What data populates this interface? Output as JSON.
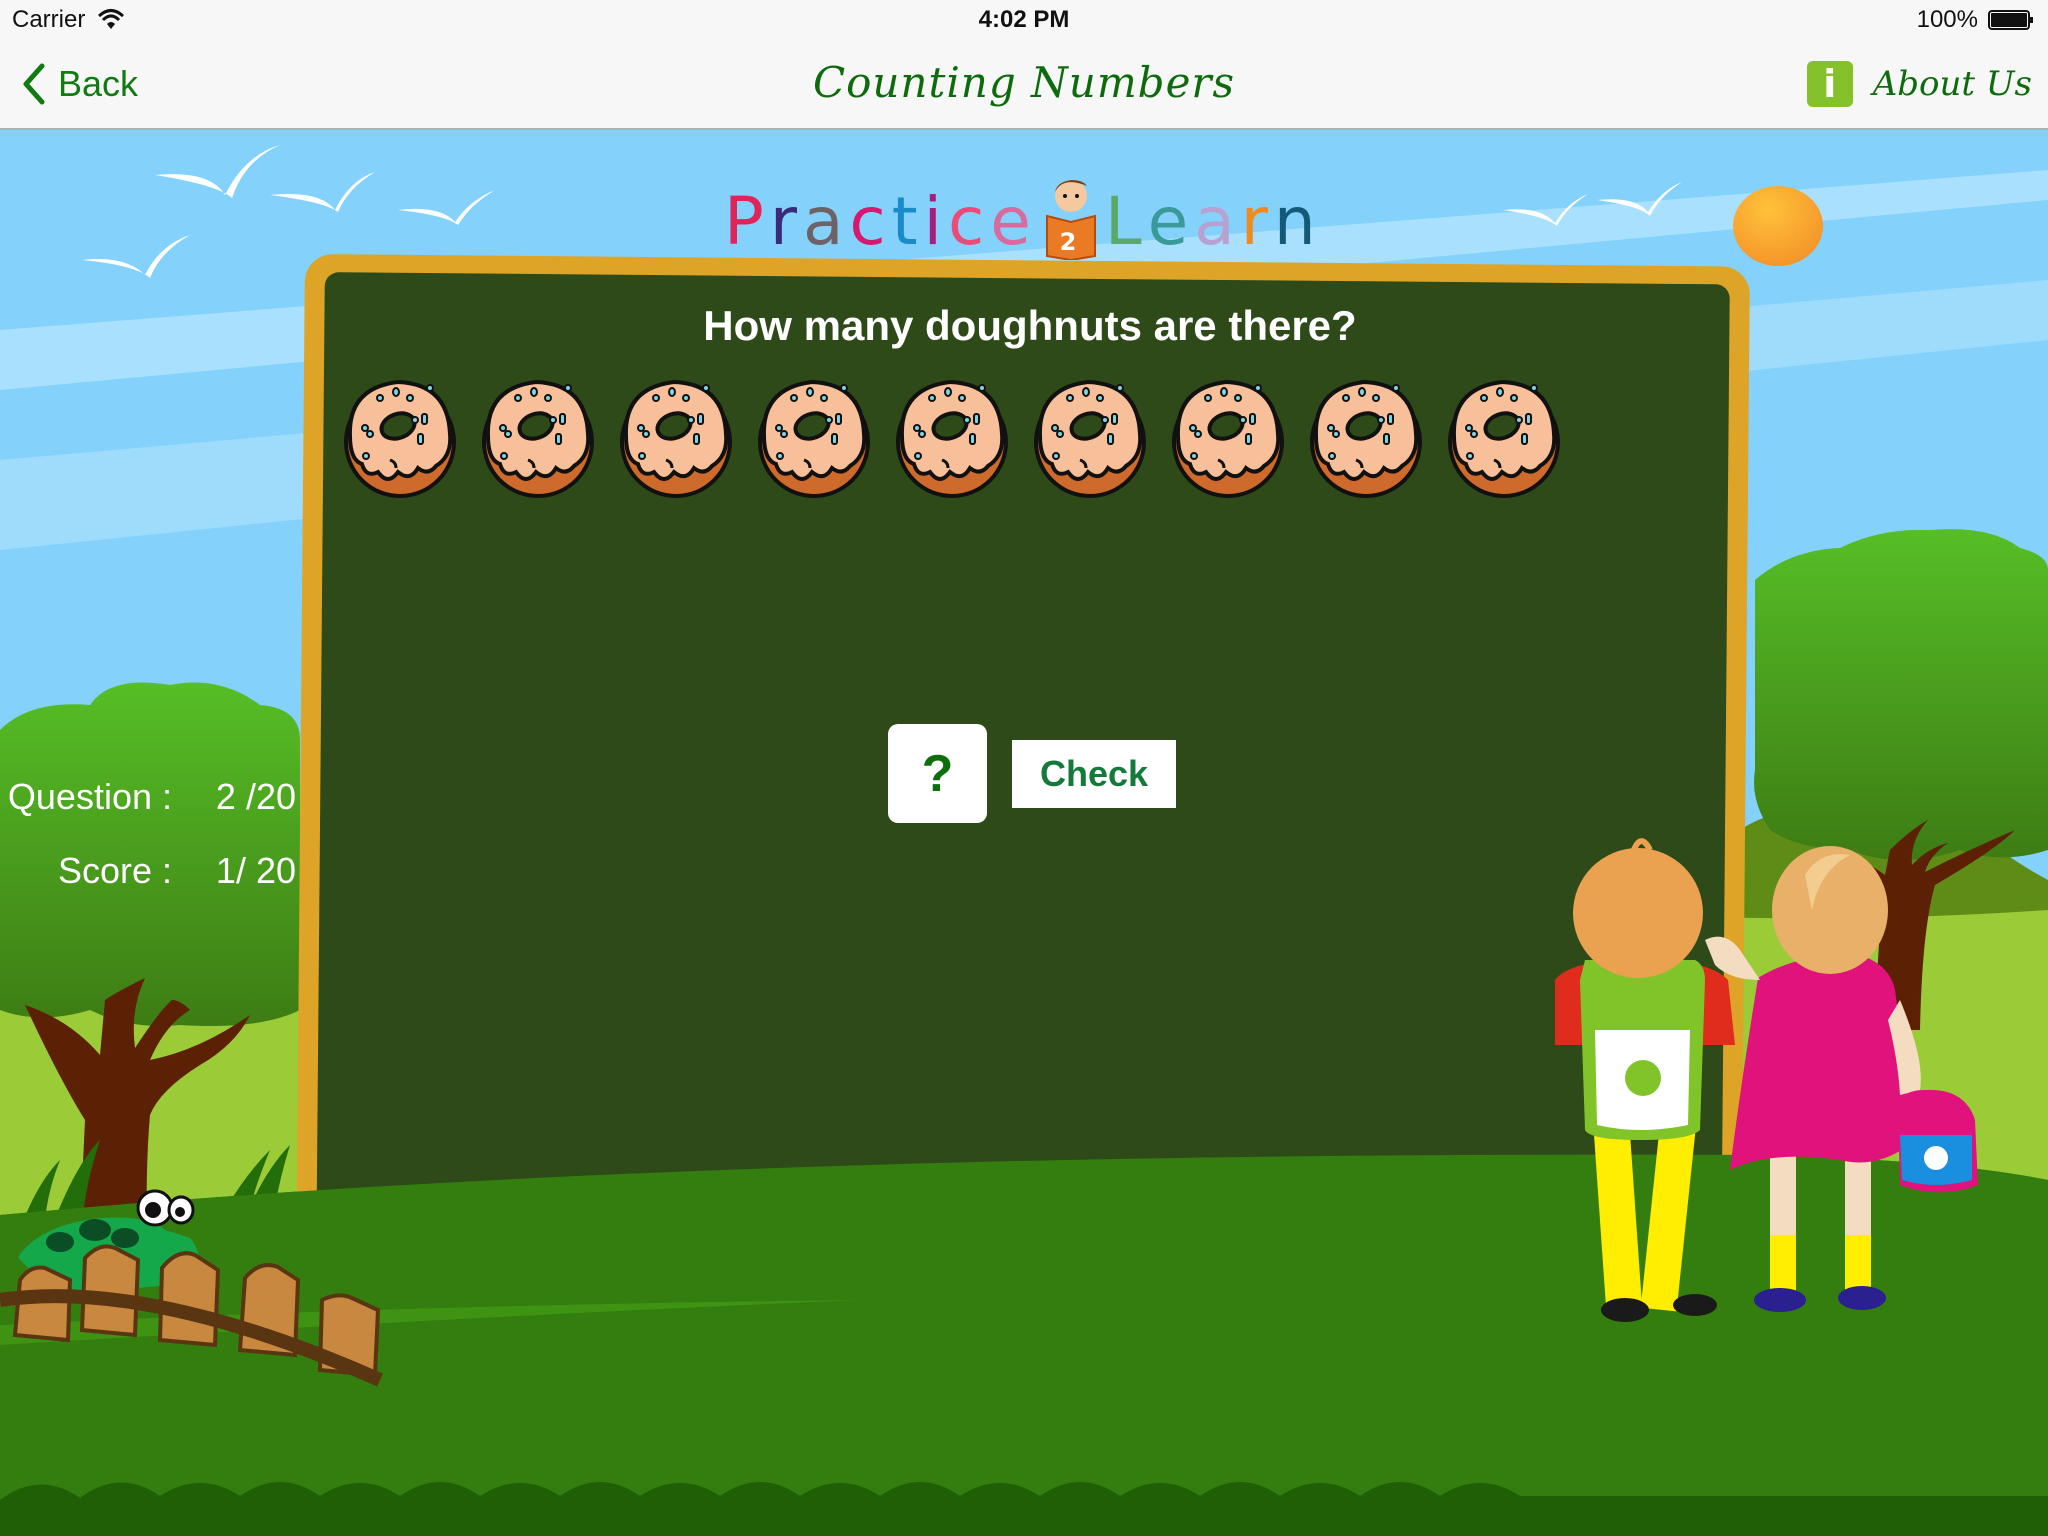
{
  "status_bar": {
    "carrier": "Carrier",
    "time": "4:02 PM",
    "battery_percent": "100%",
    "battery_level": 1.0
  },
  "nav": {
    "back_label": "Back",
    "title": "Counting Numbers",
    "about_label": "About Us",
    "info_glyph": "i"
  },
  "logo": {
    "word1": [
      "P",
      "r",
      "a",
      "c",
      "t",
      "i",
      "c",
      "e"
    ],
    "word1_colors": [
      "#e0245a",
      "#3a2a7a",
      "#6e6266",
      "#d8176e",
      "#1a8ac8",
      "#a81e7e",
      "#ee4a78",
      "#d86a9e"
    ],
    "number": "2",
    "word2": [
      "L",
      "e",
      "a",
      "r",
      "n"
    ],
    "word2_colors": [
      "#5aa86a",
      "#3a9a9a",
      "#b8a0d0",
      "#f08a1a",
      "#145a78"
    ]
  },
  "game": {
    "question": "How many doughnuts are there?",
    "item_name": "doughnut",
    "item_count": 9,
    "answer_placeholder": "?",
    "check_label": "Check"
  },
  "progress": {
    "question_label": "Question :",
    "question_value": "2 /20",
    "question_current": 2,
    "question_total": 20,
    "score_label": "Score :",
    "score_value": "1/ 20",
    "score_current": 1,
    "score_total": 20
  },
  "colors": {
    "nav_green": "#0d6b0d",
    "board_frame": "#dea427",
    "board_surface": "#2d4a18",
    "info_badge": "#84c12a",
    "sky": "#84d2fb",
    "grass": "#347d0f"
  }
}
